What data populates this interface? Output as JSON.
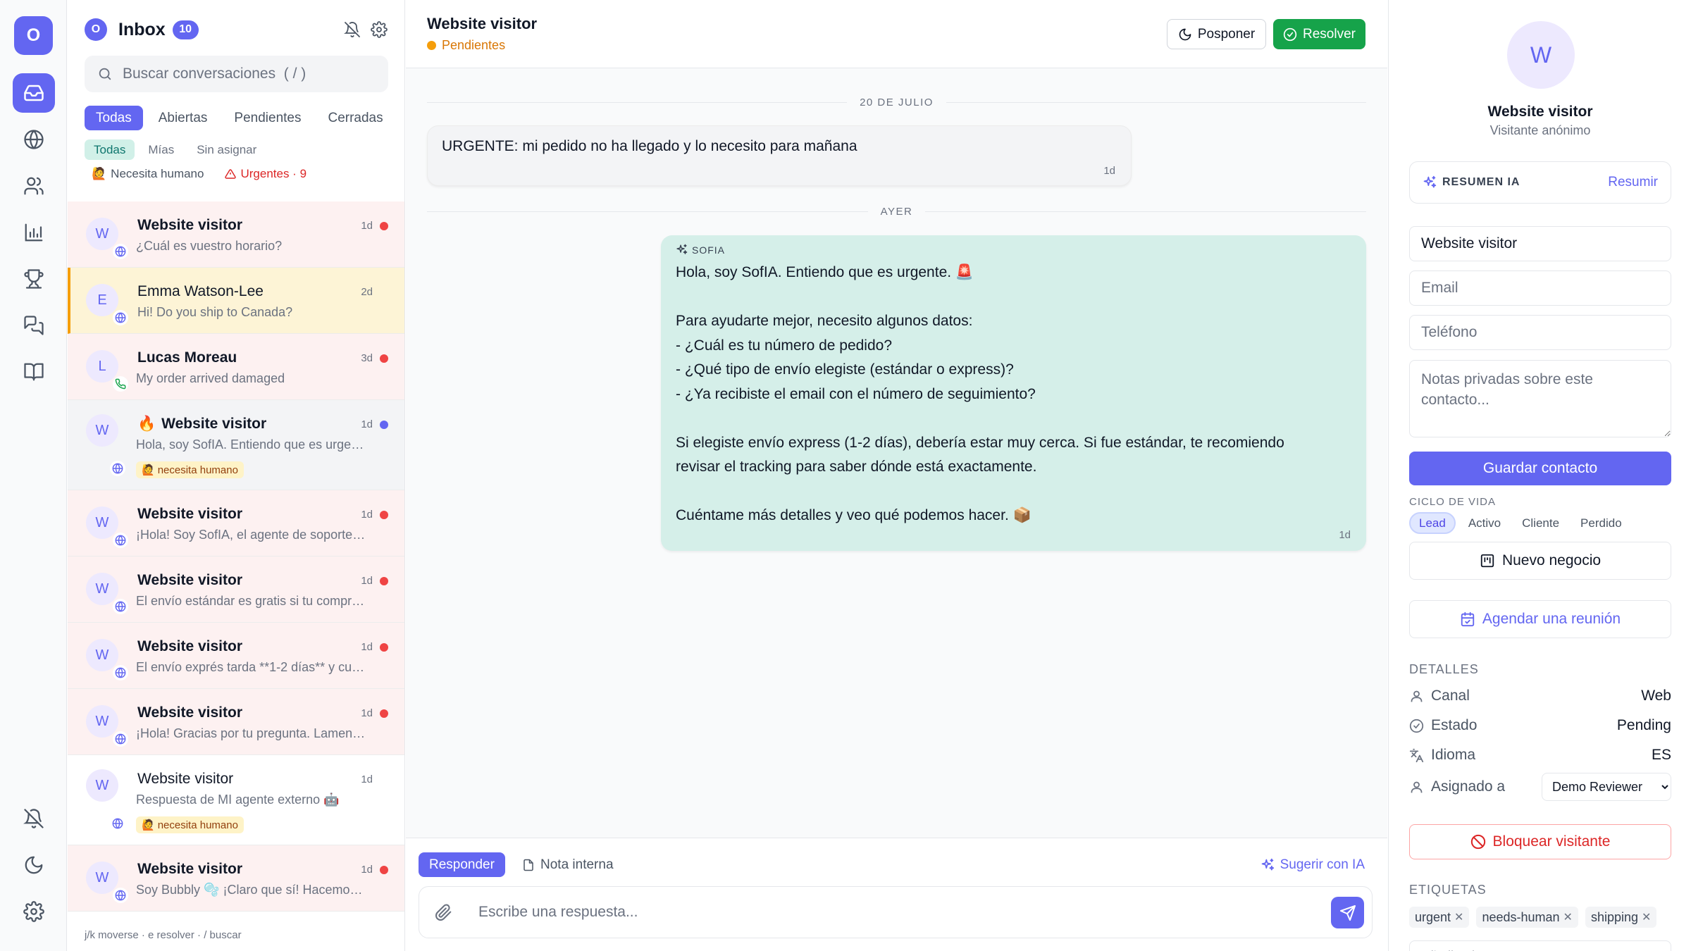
{
  "rail": {
    "logo": "O",
    "items": [
      {
        "icon": "inbox-icon",
        "active": true
      },
      {
        "icon": "globe-icon"
      },
      {
        "icon": "users-icon"
      },
      {
        "icon": "chart-icon"
      },
      {
        "icon": "trophy-icon"
      },
      {
        "icon": "chat-bubbles-icon"
      },
      {
        "icon": "book-icon"
      }
    ],
    "bottom": [
      {
        "icon": "bell-off-icon"
      },
      {
        "icon": "moon-icon"
      },
      {
        "icon": "gear-icon"
      }
    ]
  },
  "inbox": {
    "avatar": "O",
    "title": "Inbox",
    "count": "10",
    "search_placeholder": "Buscar conversaciones  ( / )",
    "tabs": [
      "Todas",
      "Abiertas",
      "Pendientes",
      "Cerradas"
    ],
    "subtabs": [
      "Todas",
      "Mías",
      "Sin asignar"
    ],
    "filter_human": "Necesita humano",
    "filter_urgent": "Urgentes · 9",
    "conversations": [
      {
        "initial": "W",
        "name": "Website visitor",
        "preview": "¿Cuál es vuestro horario?",
        "time": "1d",
        "dot": "red",
        "channel": "web",
        "style": "urgent"
      },
      {
        "initial": "E",
        "name": "Emma Watson-Lee",
        "preview": "Hi! Do you ship to Canada?",
        "time": "2d",
        "channel": "web",
        "style": "selected"
      },
      {
        "initial": "L",
        "name": "Lucas Moreau",
        "preview": "My order arrived damaged",
        "time": "3d",
        "dot": "red",
        "channel": "phone",
        "style": "urgent"
      },
      {
        "initial": "W",
        "name": "Website visitor",
        "emoji": "🔥",
        "preview": "Hola, soy SofIA. Entiendo que es urgente. ...",
        "time": "1d",
        "dot": "blue",
        "channel": "web",
        "style": "hover",
        "badge": "necesita humano"
      },
      {
        "initial": "W",
        "name": "Website visitor",
        "preview": "¡Hola! Soy SofIA, el agente de soporte de ...",
        "time": "1d",
        "dot": "red",
        "channel": "web",
        "style": "urgent"
      },
      {
        "initial": "W",
        "name": "Website visitor",
        "preview": "El envío estándar es gratis si tu compra ...",
        "time": "1d",
        "dot": "red",
        "channel": "web",
        "style": "urgent"
      },
      {
        "initial": "W",
        "name": "Website visitor",
        "preview": "El envío exprés tarda **1-2 días** y cue...",
        "time": "1d",
        "dot": "red",
        "channel": "web",
        "style": "urgent"
      },
      {
        "initial": "W",
        "name": "Website visitor",
        "preview": "¡Hola! Gracias por tu pregunta. Lamenta...",
        "time": "1d",
        "dot": "red",
        "channel": "web",
        "style": "urgent"
      },
      {
        "initial": "W",
        "name": "Website visitor",
        "preview": "Respuesta de MI agente externo 🤖",
        "time": "1d",
        "channel": "web",
        "style": "plain",
        "light": true,
        "badge": "necesita humano"
      },
      {
        "initial": "W",
        "name": "Website visitor",
        "preview": "Soy Bubbly 🫧 ¡Claro que sí! Hacemos e...",
        "time": "1d",
        "dot": "red",
        "channel": "web",
        "style": "urgent"
      }
    ],
    "shortcuts": "j/k moverse · e resolver · / buscar"
  },
  "chat": {
    "title": "Website visitor",
    "status": "Pendientes",
    "posponer": "Posponer",
    "resolver": "Resolver",
    "date1": "20 DE JULIO",
    "msg_in": {
      "text": "URGENTE: mi pedido no ha llegado y lo necesito para mañana",
      "time": "1d"
    },
    "date2": "AYER",
    "msg_out": {
      "sender": "SOFIA",
      "body": "Hola, soy SofIA. Entiendo que es urgente. 🚨\n\nPara ayudarte mejor, necesito algunos datos:\n- ¿Cuál es tu número de pedido?\n- ¿Qué tipo de envío elegiste (estándar o express)?\n- ¿Ya recibiste el email con el número de seguimiento?\n\nSi elegiste envío express (1-2 días), debería estar muy cerca. Si fue estándar, te recomiendo\nrevisar el tracking para saber dónde está exactamente.\n\nCuéntame más detalles y veo qué podemos hacer. 📦",
      "time": "1d"
    },
    "composer": {
      "tab_reply": "Responder",
      "tab_note": "Nota interna",
      "suggest": "Sugerir con IA",
      "placeholder": "Escribe una respuesta..."
    }
  },
  "contact": {
    "initial": "W",
    "name": "Website visitor",
    "subtitle": "Visitante anónimo",
    "ai_label": "RESUMEN IA",
    "ai_action": "Resumir",
    "name_value": "Website visitor",
    "email_placeholder": "Email",
    "phone_placeholder": "Teléfono",
    "notes_placeholder": "Notas privadas sobre este contacto...",
    "save": "Guardar contacto",
    "lifecycle_label": "CICLO DE VIDA",
    "lifecycle": [
      "Lead",
      "Activo",
      "Cliente",
      "Perdido"
    ],
    "new_deal": "Nuevo negocio",
    "schedule": "Agendar una reunión",
    "details_label": "DETALLES",
    "details": [
      {
        "label": "Canal",
        "value": "Web",
        "icon": "user-icon"
      },
      {
        "label": "Estado",
        "value": "Pending",
        "icon": "check-circle-icon"
      },
      {
        "label": "Idioma",
        "value": "ES",
        "icon": "translate-icon"
      }
    ],
    "assigned_label": "Asignado a",
    "assigned_value": "Demo Reviewer",
    "block": "Bloquear visitante",
    "tags_label": "ETIQUETAS",
    "tags": [
      "urgent",
      "needs-human",
      "shipping"
    ],
    "tag_placeholder": "Añadir etiqueta + Enter"
  },
  "colors": {
    "accent": "#6366f1",
    "success": "#16a34a",
    "warning": "#f59e0b",
    "danger": "#ef4444",
    "bubble_out": "#d5efe9"
  }
}
